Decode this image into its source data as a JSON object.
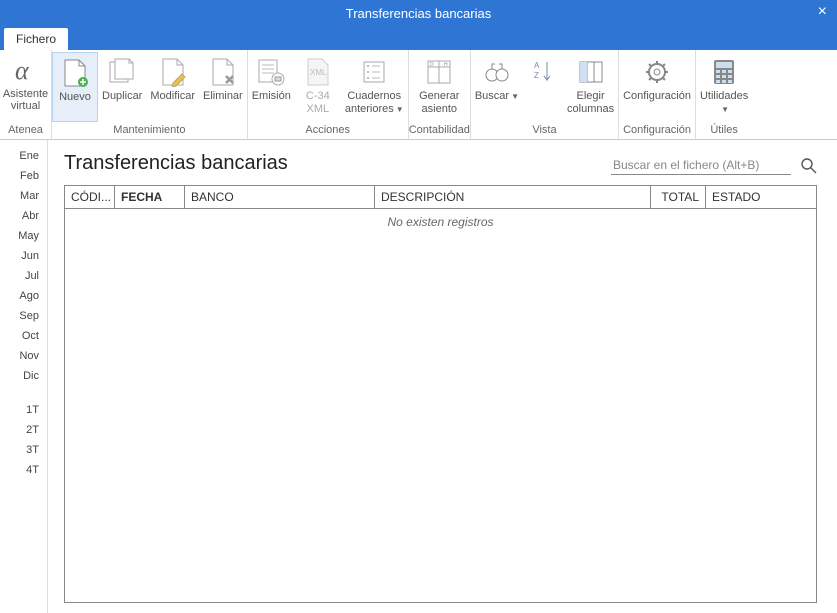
{
  "window": {
    "title": "Transferencias bancarias"
  },
  "tabs": {
    "file": "Fichero"
  },
  "ribbon": {
    "first": {
      "label": "Asistente\nvirtual",
      "group": "Atenea"
    },
    "mantenimiento": {
      "group": "Mantenimiento",
      "nuevo": "Nuevo",
      "duplicar": "Duplicar",
      "modificar": "Modificar",
      "eliminar": "Eliminar"
    },
    "acciones": {
      "group": "Acciones",
      "emision": "Emisión",
      "c34": "C-34\nXML",
      "cuadernos": "Cuadernos\nanteriores"
    },
    "contabilidad": {
      "group": "Contabilidad",
      "generar": "Generar\nasiento"
    },
    "vista": {
      "group": "Vista",
      "buscar": "Buscar",
      "sort": "",
      "columnas": "Elegir\ncolumnas"
    },
    "configuracion": {
      "group": "Configuración",
      "configuracion": "Configuración"
    },
    "utiles": {
      "group": "Útiles",
      "utilidades": "Utilidades"
    }
  },
  "sidebar": {
    "months": [
      "Ene",
      "Feb",
      "Mar",
      "Abr",
      "May",
      "Jun",
      "Jul",
      "Ago",
      "Sep",
      "Oct",
      "Nov",
      "Dic"
    ],
    "quarters": [
      "1T",
      "2T",
      "3T",
      "4T"
    ]
  },
  "main": {
    "title": "Transferencias bancarias",
    "search_placeholder": "Buscar en el fichero (Alt+B)",
    "columns": {
      "codigo": "CÓDI...",
      "fecha": "FECHA",
      "banco": "BANCO",
      "descripcion": "DESCRIPCIÓN",
      "total": "TOTAL",
      "estado": "ESTADO"
    },
    "empty": "No existen registros"
  }
}
